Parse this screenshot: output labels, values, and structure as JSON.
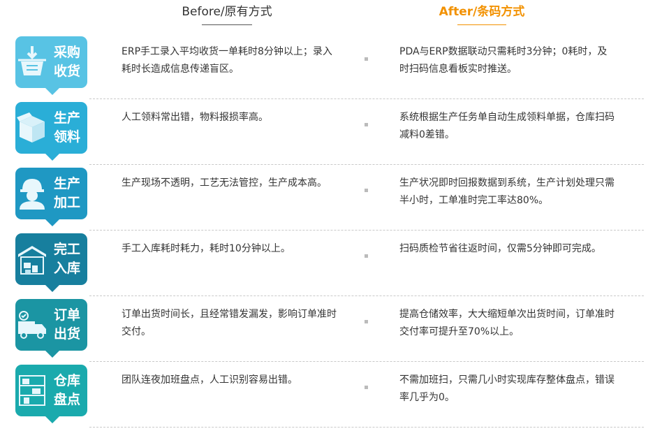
{
  "header": {
    "before": "Before/原有方式",
    "after": "After/条码方式"
  },
  "rows": [
    {
      "label1": "采购",
      "label2": "收货",
      "icon": "basket-icon",
      "color": "#58c3e4",
      "before": "ERP手工录入平均收货一单耗时8分钟以上；录入耗时长造成信息传递盲区。",
      "after": "PDA与ERP数据联动只需耗时3分钟；0耗时，及时扫码信息看板实时推送。"
    },
    {
      "label1": "生产",
      "label2": "领料",
      "icon": "box-icon",
      "color": "#2aaed7",
      "before": "人工领料常出错，物料报损率高。",
      "after": "系统根据生产任务单自动生成领料单据，仓库扫码减料0差错。"
    },
    {
      "label1": "生产",
      "label2": "加工",
      "icon": "worker-icon",
      "color": "#1f98c3",
      "before": "生产现场不透明，工艺无法管控，生产成本高。",
      "after": "生产状况即时回报数据到系统，生产计划处理只需半小时，工单准时完工率达80%。"
    },
    {
      "label1": "完工",
      "label2": "入库",
      "icon": "warehouse-icon",
      "color": "#177f9e",
      "before": "手工入库耗时耗力，耗时10分钟以上。",
      "after": "扫码质检节省往返时间，仅需5分钟即可完成。"
    },
    {
      "label1": "订单",
      "label2": "出货",
      "icon": "truck-icon",
      "color": "#1b95a3",
      "before": "订单出货时间长，且经常错发漏发，影响订单准时交付。",
      "after": "提高仓储效率，大大缩短单次出货时间，订单准时交付率可提升至70%以上。"
    },
    {
      "label1": "仓库",
      "label2": "盘点",
      "icon": "shelves-icon",
      "color": "#1aaaad",
      "before": "团队连夜加班盘点，人工识别容易出错。",
      "after": "不需加班扫，只需几小时实现库存整体盘点，错误率几乎为0。"
    }
  ]
}
